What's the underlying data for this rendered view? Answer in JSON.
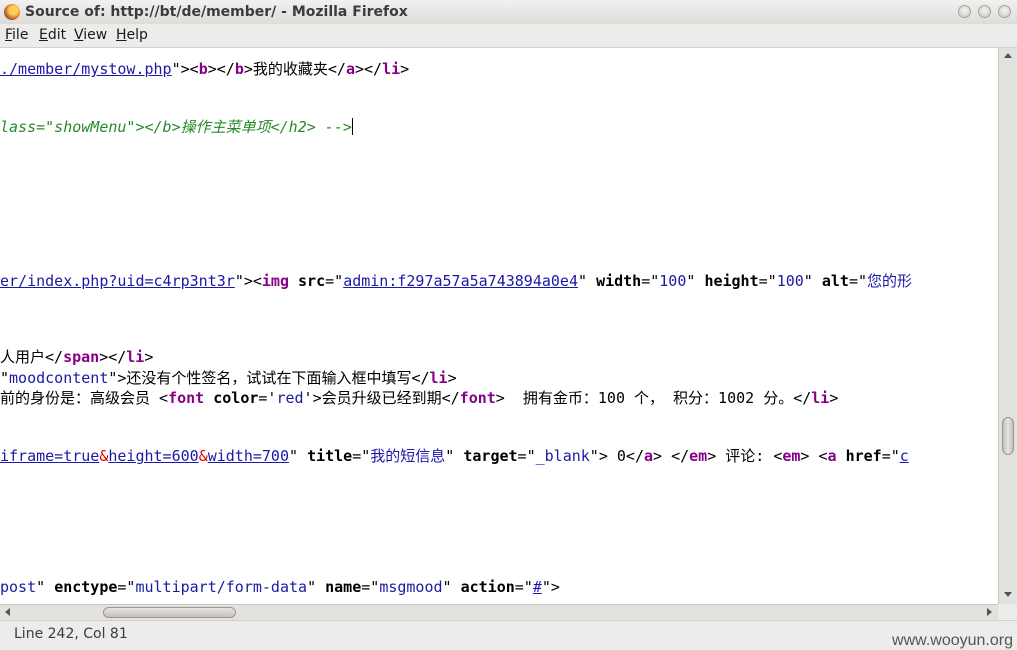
{
  "window": {
    "title": "Source of: http://bt/de/member/ - Mozilla Firefox"
  },
  "menu": [
    {
      "key": "F",
      "rest": "ile"
    },
    {
      "key": "E",
      "rest": "dit"
    },
    {
      "key": "V",
      "rest": "iew"
    },
    {
      "key": "H",
      "rest": "elp"
    }
  ],
  "source_lines": [
    [
      {
        "t": "./member/mystow.php",
        "c": "lk"
      },
      {
        "t": "\"><"
      },
      {
        "t": "b",
        "c": "tg"
      },
      {
        "t": "></"
      },
      {
        "t": "b",
        "c": "tg"
      },
      {
        "t": ">我的收藏夹</"
      },
      {
        "t": "a",
        "c": "tg"
      },
      {
        "t": "></"
      },
      {
        "t": "li",
        "c": "tg"
      },
      {
        "t": ">"
      }
    ],
    [
      {
        "t": "lass=\"showMenu\"></b>操作主菜单项</h2> -->",
        "c": "cm"
      },
      {
        "caret": true
      }
    ],
    [
      {
        "t": "er/index.php?uid=c4rp3nt3r",
        "c": "lk"
      },
      {
        "t": "\"><"
      },
      {
        "t": "img",
        "c": "tg"
      },
      {
        "t": " "
      },
      {
        "t": "src",
        "c": "at"
      },
      {
        "t": "=\""
      },
      {
        "t": "admin:f297a57a5a743894a0e4",
        "c": "lk"
      },
      {
        "t": "\" "
      },
      {
        "t": "width",
        "c": "at"
      },
      {
        "t": "=\""
      },
      {
        "t": "100",
        "c": "av"
      },
      {
        "t": "\" "
      },
      {
        "t": "height",
        "c": "at"
      },
      {
        "t": "=\""
      },
      {
        "t": "100",
        "c": "av"
      },
      {
        "t": "\" "
      },
      {
        "t": "alt",
        "c": "at"
      },
      {
        "t": "=\""
      },
      {
        "t": "您的形",
        "c": "av"
      }
    ],
    [
      {
        "t": "人用户</"
      },
      {
        "t": "span",
        "c": "tg"
      },
      {
        "t": "></"
      },
      {
        "t": "li",
        "c": "tg"
      },
      {
        "t": ">"
      }
    ],
    [
      {
        "t": "\""
      },
      {
        "t": "moodcontent",
        "c": "av"
      },
      {
        "t": "\">还没有个性签名，试试在下面输入框中填写</"
      },
      {
        "t": "li",
        "c": "tg"
      },
      {
        "t": ">"
      }
    ],
    [
      {
        "t": "前的身份是：高级会员 <"
      },
      {
        "t": "font",
        "c": "tg"
      },
      {
        "t": " "
      },
      {
        "t": "color",
        "c": "at"
      },
      {
        "t": "='"
      },
      {
        "t": "red",
        "c": "av"
      },
      {
        "t": "'>会员升级已经到期</"
      },
      {
        "t": "font",
        "c": "tg"
      },
      {
        "t": ">  拥有金币：100 个， 积分：1002 分。</"
      },
      {
        "t": "li",
        "c": "tg"
      },
      {
        "t": ">"
      }
    ],
    [
      {
        "t": "iframe=true",
        "c": "lk"
      },
      {
        "t": "&",
        "c": "en"
      },
      {
        "t": "height=600",
        "c": "lk"
      },
      {
        "t": "&",
        "c": "en"
      },
      {
        "t": "width=700",
        "c": "lk"
      },
      {
        "t": "\" "
      },
      {
        "t": "title",
        "c": "at"
      },
      {
        "t": "=\""
      },
      {
        "t": "我的短信息",
        "c": "av"
      },
      {
        "t": "\" "
      },
      {
        "t": "target",
        "c": "at"
      },
      {
        "t": "=\""
      },
      {
        "t": "_blank",
        "c": "av"
      },
      {
        "t": "\"> 0</"
      },
      {
        "t": "a",
        "c": "tg"
      },
      {
        "t": "> </"
      },
      {
        "t": "em",
        "c": "tg"
      },
      {
        "t": "> 评论: <"
      },
      {
        "t": "em",
        "c": "tg"
      },
      {
        "t": "> <"
      },
      {
        "t": "a",
        "c": "tg"
      },
      {
        "t": " "
      },
      {
        "t": "href",
        "c": "at"
      },
      {
        "t": "=\""
      },
      {
        "t": "c",
        "c": "lk"
      }
    ],
    [
      {
        "t": "post",
        "c": "av"
      },
      {
        "t": "\" "
      },
      {
        "t": "enctype",
        "c": "at"
      },
      {
        "t": "=\""
      },
      {
        "t": "multipart/form-data",
        "c": "av"
      },
      {
        "t": "\" "
      },
      {
        "t": "name",
        "c": "at"
      },
      {
        "t": "=\""
      },
      {
        "t": "msgmood",
        "c": "av"
      },
      {
        "t": "\" "
      },
      {
        "t": "action",
        "c": "at"
      },
      {
        "t": "=\""
      },
      {
        "t": "#",
        "c": "lk"
      },
      {
        "t": "\">"
      }
    ]
  ],
  "status": {
    "position": "Line 242, Col 81"
  },
  "watermark": "www.wooyun.org"
}
